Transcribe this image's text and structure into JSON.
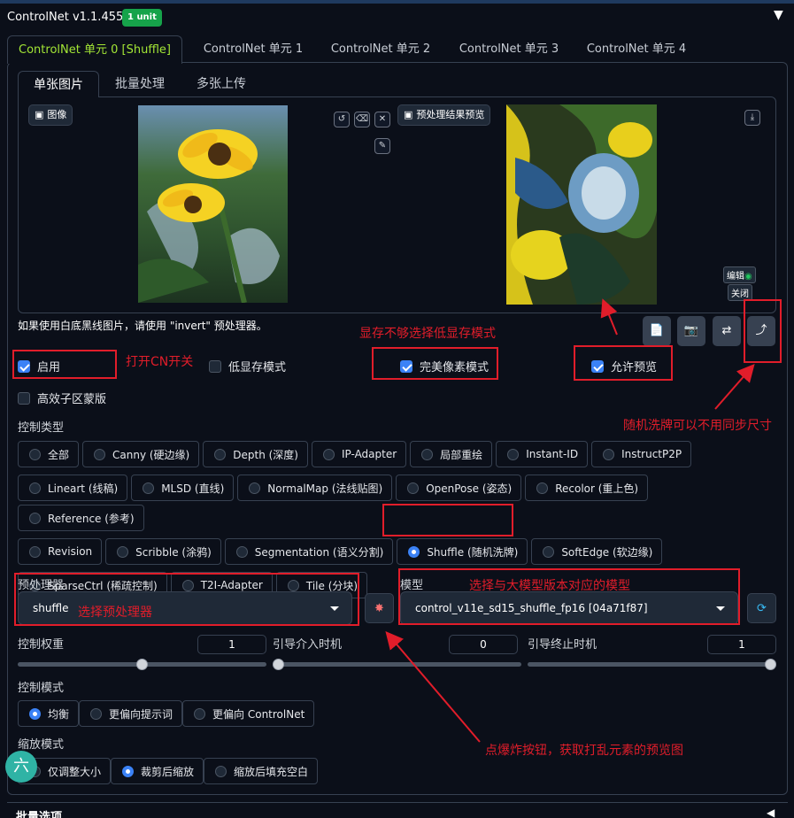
{
  "header": {
    "title": "ControlNet v1.1.455",
    "badge": "1 unit",
    "collapse_icon": "triangle-down-icon"
  },
  "unit_tabs": [
    "ControlNet 单元 0 [Shuffle]",
    "ControlNet 单元 1",
    "ControlNet 单元 2",
    "ControlNet 单元 3",
    "ControlNet 单元 4"
  ],
  "input_tabs": [
    "单张图片",
    "批量处理",
    "多张上传"
  ],
  "image_panel": {
    "image_label": "图像",
    "preview_label": "预处理结果预览",
    "edit_label": "编辑",
    "close_label": "关闭"
  },
  "hint_text": "如果使用白底黑线图片，请使用 \"invert\" 预处理器。",
  "checkboxes": {
    "enable": {
      "label": "启用",
      "checked": true
    },
    "low_vram": {
      "label": "低显存模式",
      "checked": false
    },
    "pixel_perfect": {
      "label": "完美像素模式",
      "checked": true
    },
    "allow_preview": {
      "label": "允许预览",
      "checked": true
    },
    "mask_upload": {
      "label": "高效子区蒙版",
      "checked": false
    }
  },
  "control_type": {
    "label": "控制类型",
    "options": [
      "全部",
      "Canny (硬边缘)",
      "Depth (深度)",
      "IP-Adapter",
      "局部重绘",
      "Instant-ID",
      "InstructP2P",
      "Lineart (线稿)",
      "MLSD (直线)",
      "NormalMap (法线贴图)",
      "OpenPose (姿态)",
      "Recolor (重上色)",
      "Reference (参考)",
      "Revision",
      "Scribble (涂鸦)",
      "Segmentation (语义分割)",
      "Shuffle (随机洗牌)",
      "SoftEdge (软边缘)",
      "SparseCtrl (稀疏控制)",
      "T2I-Adapter",
      "Tile (分块)"
    ],
    "selected": "Shuffle (随机洗牌)"
  },
  "preprocessor": {
    "label": "预处理器",
    "value": "shuffle"
  },
  "model": {
    "label": "模型",
    "value": "control_v11e_sd15_shuffle_fp16 [04a71f87]"
  },
  "weight": {
    "label": "控制权重",
    "value": "1",
    "fraction": 0.5
  },
  "start_step": {
    "label": "引导介入时机",
    "value": "0",
    "fraction": 0.0
  },
  "end_step": {
    "label": "引导终止时机",
    "value": "1",
    "fraction": 1.0
  },
  "control_mode": {
    "label": "控制模式",
    "options": [
      "均衡",
      "更偏向提示词",
      "更偏向 ControlNet"
    ],
    "selected": "均衡"
  },
  "resize_mode": {
    "label": "缩放模式",
    "options": [
      "仅调整大小",
      "裁剪后缩放",
      "缩放后填充空白"
    ],
    "selected": "裁剪后缩放"
  },
  "batch_options": {
    "label": "批量选项"
  },
  "avatar_char": "六",
  "annotations": {
    "low_vram": "显存不够选择低显存模式",
    "enable": "打开CN开关",
    "shuffle_random": "随机洗牌可以不用同步尺寸",
    "preprocessor": "选择预处理器",
    "model": "选择与大模型版本对应的模型",
    "explode": "点爆炸按钮，获取打乱元素的预览图"
  },
  "colors": {
    "accent": "#3b82f6",
    "active_tab": "#a3e635",
    "annotation": "#e11d2a",
    "badge": "#16a34a"
  }
}
